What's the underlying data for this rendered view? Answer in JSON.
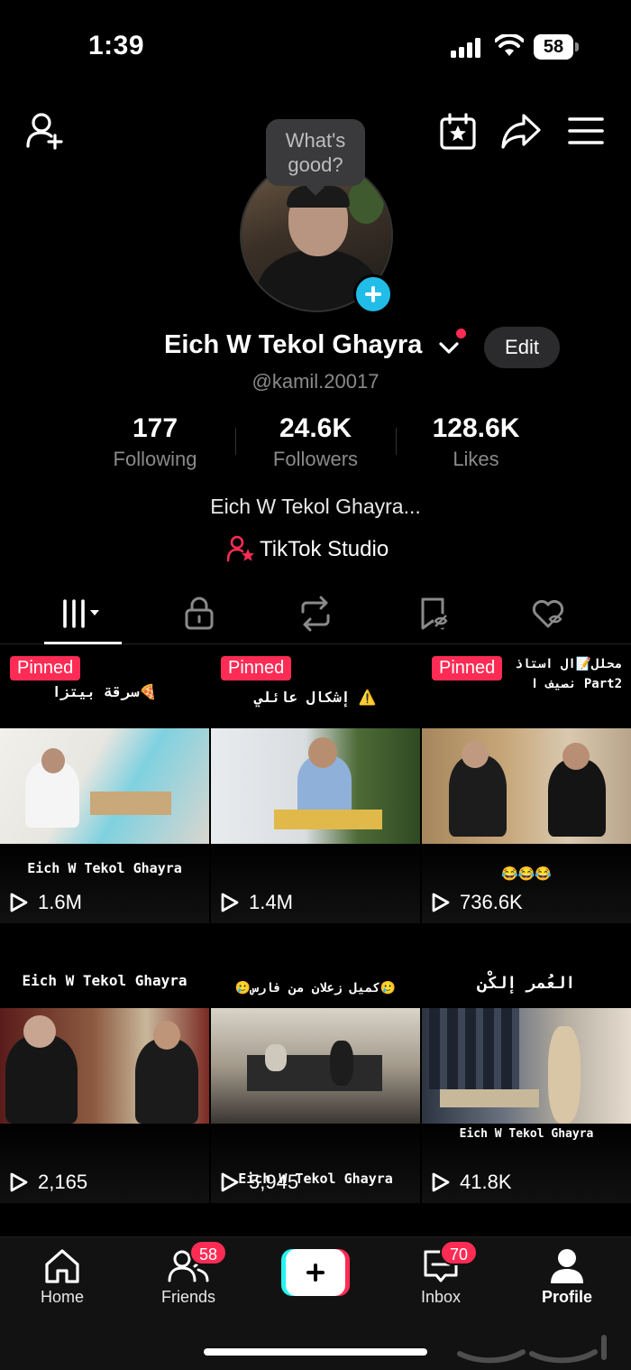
{
  "status": {
    "time": "1:39",
    "battery": "58"
  },
  "profile": {
    "bubble": "What's good?",
    "name": "Eich W Tekol Ghayra",
    "username": "@kamil.20017",
    "edit_label": "Edit",
    "bio": "Eich W Tekol Ghayra...",
    "studio_label": "TikTok Studio"
  },
  "stats": [
    {
      "value": "177",
      "label": "Following"
    },
    {
      "value": "24.6K",
      "label": "Followers"
    },
    {
      "value": "128.6K",
      "label": "Likes"
    }
  ],
  "tabs": [
    "videos-icon",
    "lock-icon",
    "repost-icon",
    "bookmark-icon",
    "liked-icon"
  ],
  "videos": [
    {
      "pinned": "Pinned",
      "caption_top": "سرقة بيتزا🍕",
      "caption_bottom": "Eich W Tekol Ghayra",
      "views": "1.6M"
    },
    {
      "pinned": "Pinned",
      "caption_top": "إشكال عائلي ⚠️",
      "caption_bottom": "",
      "views": "1.4M"
    },
    {
      "pinned": "Pinned",
      "caption_top": "محلل📝ال استاذ نصيف ا Part2",
      "caption_bottom": "😂😂😂",
      "views": "736.6K"
    },
    {
      "pinned": "",
      "caption_top": "Eich W Tekol Ghayra",
      "caption_bottom": "",
      "views": "2,165"
    },
    {
      "pinned": "",
      "caption_top": "🥲كميل زعلان من فارس🥲",
      "caption_bottom": "Eich W Tekol Ghayra",
      "views": "5,945"
    },
    {
      "pinned": "",
      "caption_top": "العُمر إلكْن",
      "caption_bottom": "Eich W Tekol Ghayra",
      "views": "41.8K"
    }
  ],
  "nav": {
    "home": "Home",
    "friends": "Friends",
    "friends_badge": "58",
    "inbox": "Inbox",
    "inbox_badge": "70",
    "profile": "Profile"
  },
  "colors": {
    "accent": "#fe2c55",
    "cyan": "#25f4ee",
    "add_avatar": "#20bde8"
  }
}
